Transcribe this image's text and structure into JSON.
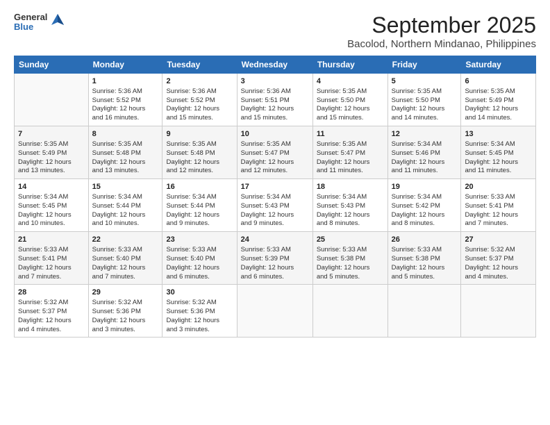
{
  "logo": {
    "general": "General",
    "blue": "Blue"
  },
  "header": {
    "title": "September 2025",
    "subtitle": "Bacolod, Northern Mindanao, Philippines"
  },
  "weekdays": [
    "Sunday",
    "Monday",
    "Tuesday",
    "Wednesday",
    "Thursday",
    "Friday",
    "Saturday"
  ],
  "weeks": [
    [
      {
        "day": "",
        "lines": []
      },
      {
        "day": "1",
        "lines": [
          "Sunrise: 5:36 AM",
          "Sunset: 5:52 PM",
          "Daylight: 12 hours",
          "and 16 minutes."
        ]
      },
      {
        "day": "2",
        "lines": [
          "Sunrise: 5:36 AM",
          "Sunset: 5:52 PM",
          "Daylight: 12 hours",
          "and 15 minutes."
        ]
      },
      {
        "day": "3",
        "lines": [
          "Sunrise: 5:36 AM",
          "Sunset: 5:51 PM",
          "Daylight: 12 hours",
          "and 15 minutes."
        ]
      },
      {
        "day": "4",
        "lines": [
          "Sunrise: 5:35 AM",
          "Sunset: 5:50 PM",
          "Daylight: 12 hours",
          "and 15 minutes."
        ]
      },
      {
        "day": "5",
        "lines": [
          "Sunrise: 5:35 AM",
          "Sunset: 5:50 PM",
          "Daylight: 12 hours",
          "and 14 minutes."
        ]
      },
      {
        "day": "6",
        "lines": [
          "Sunrise: 5:35 AM",
          "Sunset: 5:49 PM",
          "Daylight: 12 hours",
          "and 14 minutes."
        ]
      }
    ],
    [
      {
        "day": "7",
        "lines": [
          "Sunrise: 5:35 AM",
          "Sunset: 5:49 PM",
          "Daylight: 12 hours",
          "and 13 minutes."
        ]
      },
      {
        "day": "8",
        "lines": [
          "Sunrise: 5:35 AM",
          "Sunset: 5:48 PM",
          "Daylight: 12 hours",
          "and 13 minutes."
        ]
      },
      {
        "day": "9",
        "lines": [
          "Sunrise: 5:35 AM",
          "Sunset: 5:48 PM",
          "Daylight: 12 hours",
          "and 12 minutes."
        ]
      },
      {
        "day": "10",
        "lines": [
          "Sunrise: 5:35 AM",
          "Sunset: 5:47 PM",
          "Daylight: 12 hours",
          "and 12 minutes."
        ]
      },
      {
        "day": "11",
        "lines": [
          "Sunrise: 5:35 AM",
          "Sunset: 5:47 PM",
          "Daylight: 12 hours",
          "and 11 minutes."
        ]
      },
      {
        "day": "12",
        "lines": [
          "Sunrise: 5:34 AM",
          "Sunset: 5:46 PM",
          "Daylight: 12 hours",
          "and 11 minutes."
        ]
      },
      {
        "day": "13",
        "lines": [
          "Sunrise: 5:34 AM",
          "Sunset: 5:45 PM",
          "Daylight: 12 hours",
          "and 11 minutes."
        ]
      }
    ],
    [
      {
        "day": "14",
        "lines": [
          "Sunrise: 5:34 AM",
          "Sunset: 5:45 PM",
          "Daylight: 12 hours",
          "and 10 minutes."
        ]
      },
      {
        "day": "15",
        "lines": [
          "Sunrise: 5:34 AM",
          "Sunset: 5:44 PM",
          "Daylight: 12 hours",
          "and 10 minutes."
        ]
      },
      {
        "day": "16",
        "lines": [
          "Sunrise: 5:34 AM",
          "Sunset: 5:44 PM",
          "Daylight: 12 hours",
          "and 9 minutes."
        ]
      },
      {
        "day": "17",
        "lines": [
          "Sunrise: 5:34 AM",
          "Sunset: 5:43 PM",
          "Daylight: 12 hours",
          "and 9 minutes."
        ]
      },
      {
        "day": "18",
        "lines": [
          "Sunrise: 5:34 AM",
          "Sunset: 5:43 PM",
          "Daylight: 12 hours",
          "and 8 minutes."
        ]
      },
      {
        "day": "19",
        "lines": [
          "Sunrise: 5:34 AM",
          "Sunset: 5:42 PM",
          "Daylight: 12 hours",
          "and 8 minutes."
        ]
      },
      {
        "day": "20",
        "lines": [
          "Sunrise: 5:33 AM",
          "Sunset: 5:41 PM",
          "Daylight: 12 hours",
          "and 7 minutes."
        ]
      }
    ],
    [
      {
        "day": "21",
        "lines": [
          "Sunrise: 5:33 AM",
          "Sunset: 5:41 PM",
          "Daylight: 12 hours",
          "and 7 minutes."
        ]
      },
      {
        "day": "22",
        "lines": [
          "Sunrise: 5:33 AM",
          "Sunset: 5:40 PM",
          "Daylight: 12 hours",
          "and 7 minutes."
        ]
      },
      {
        "day": "23",
        "lines": [
          "Sunrise: 5:33 AM",
          "Sunset: 5:40 PM",
          "Daylight: 12 hours",
          "and 6 minutes."
        ]
      },
      {
        "day": "24",
        "lines": [
          "Sunrise: 5:33 AM",
          "Sunset: 5:39 PM",
          "Daylight: 12 hours",
          "and 6 minutes."
        ]
      },
      {
        "day": "25",
        "lines": [
          "Sunrise: 5:33 AM",
          "Sunset: 5:38 PM",
          "Daylight: 12 hours",
          "and 5 minutes."
        ]
      },
      {
        "day": "26",
        "lines": [
          "Sunrise: 5:33 AM",
          "Sunset: 5:38 PM",
          "Daylight: 12 hours",
          "and 5 minutes."
        ]
      },
      {
        "day": "27",
        "lines": [
          "Sunrise: 5:32 AM",
          "Sunset: 5:37 PM",
          "Daylight: 12 hours",
          "and 4 minutes."
        ]
      }
    ],
    [
      {
        "day": "28",
        "lines": [
          "Sunrise: 5:32 AM",
          "Sunset: 5:37 PM",
          "Daylight: 12 hours",
          "and 4 minutes."
        ]
      },
      {
        "day": "29",
        "lines": [
          "Sunrise: 5:32 AM",
          "Sunset: 5:36 PM",
          "Daylight: 12 hours",
          "and 3 minutes."
        ]
      },
      {
        "day": "30",
        "lines": [
          "Sunrise: 5:32 AM",
          "Sunset: 5:36 PM",
          "Daylight: 12 hours",
          "and 3 minutes."
        ]
      },
      {
        "day": "",
        "lines": []
      },
      {
        "day": "",
        "lines": []
      },
      {
        "day": "",
        "lines": []
      },
      {
        "day": "",
        "lines": []
      }
    ]
  ]
}
